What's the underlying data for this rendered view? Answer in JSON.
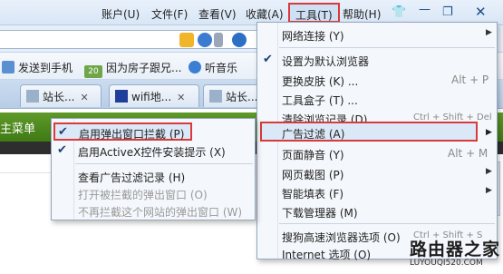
{
  "menubar": {
    "items": [
      {
        "label": "账户(U)"
      },
      {
        "label": "文件(F)"
      },
      {
        "label": "查看(V)"
      },
      {
        "label": "收藏(A)"
      },
      {
        "label": "工具(T)"
      },
      {
        "label": "帮助(H)"
      }
    ],
    "window_buttons": [
      "shirt-icon",
      "minimize-icon",
      "restore-icon",
      "close-icon"
    ]
  },
  "favorites": {
    "items": [
      {
        "label": "发送到手机",
        "icon": "phone-icon"
      },
      {
        "label": "因为房子跟兄...",
        "badge": "20",
        "icon": "news-icon"
      },
      {
        "label": "听音乐",
        "icon": "headphones-icon"
      }
    ]
  },
  "tabs": [
    {
      "label": "站长..."
    },
    {
      "label": "wifi地..."
    },
    {
      "label": "站长..."
    }
  ],
  "page": {
    "green_label": "主菜单"
  },
  "tools_menu": {
    "items": [
      {
        "label": "网络连接 (Y)",
        "arrow": true
      },
      {
        "label": "设置为默认浏览器",
        "checked": true
      },
      {
        "label": "更换皮肤 (K) ...",
        "shortcut": "Alt + P"
      },
      {
        "label": "工具盒子 (T) ..."
      },
      {
        "label": "清除浏览记录 (D) ...",
        "shortcut": "Ctrl + Shift + Del"
      },
      {
        "label": "广告过滤 (A)",
        "arrow": true,
        "highlighted": true
      },
      {
        "label": "页面静音 (Y)",
        "shortcut": "Alt + M"
      },
      {
        "label": "网页截图 (P)",
        "arrow": true
      },
      {
        "label": "智能填表 (F)",
        "arrow": true
      },
      {
        "label": "下载管理器 (M)"
      },
      {
        "label": "搜狗高速浏览器选项 (O)",
        "shortcut": "Ctrl + Shift + S"
      },
      {
        "label": "Internet 选项 (O)"
      }
    ]
  },
  "ad_submenu": {
    "items": [
      {
        "label": "启用弹出窗口拦截 (P)",
        "checked": true,
        "highlighted": true
      },
      {
        "label": "启用ActiveX控件安装提示 (X)",
        "checked": true
      },
      {
        "label": "查看广告过滤记录 (H)"
      },
      {
        "label": "打开被拦截的弹出窗口 (O)",
        "disabled": true
      },
      {
        "label": "不再拦截这个网站的弹出窗口 (W)",
        "disabled": true
      }
    ]
  },
  "watermark": {
    "title": "路由器之家",
    "url": "LUYOUQI520.COM"
  },
  "colors": {
    "highlight_border": "#d93a3a",
    "menu_bg": "#f4f7fb",
    "page_green": "#4f8a1f"
  }
}
